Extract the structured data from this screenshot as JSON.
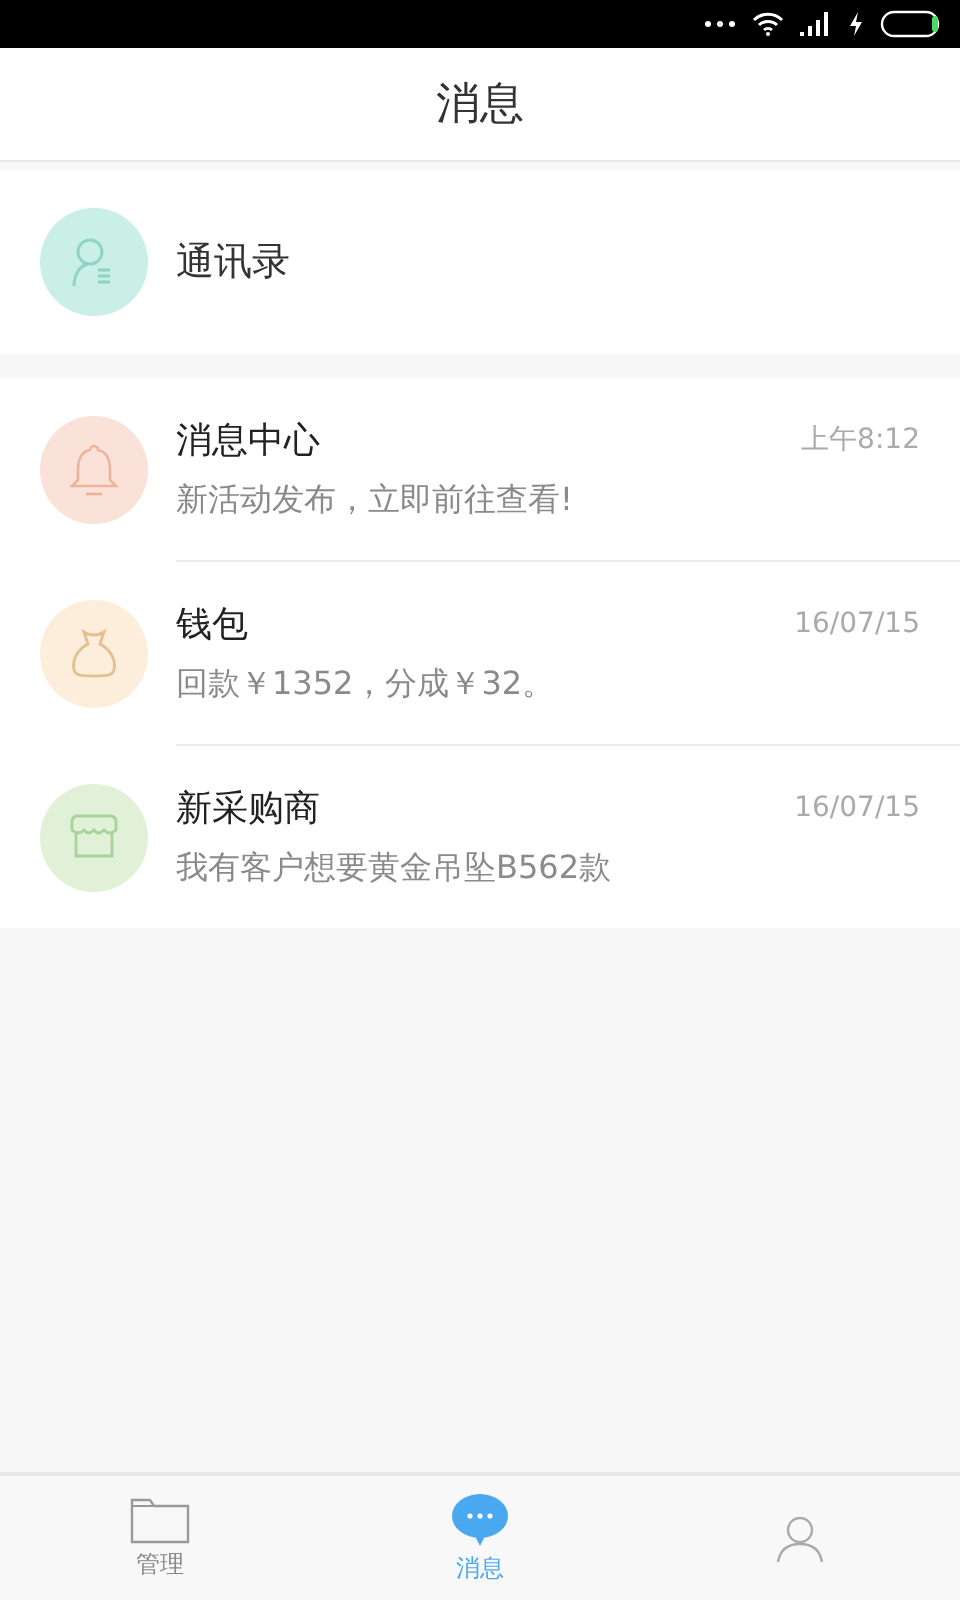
{
  "header": {
    "title": "消息"
  },
  "contacts": {
    "label": "通讯录",
    "color": "#c9efe6"
  },
  "messages": [
    {
      "title": "消息中心",
      "preview": "新活动发布，立即前往查看!",
      "time": "上午8:12",
      "color": "#fbe2d9"
    },
    {
      "title": "钱包",
      "preview": "回款￥1352，分成￥32。",
      "time": "16/07/15",
      "color": "#fdeedb"
    },
    {
      "title": "新采购商",
      "preview": "我有客户想要黄金吊坠B562款",
      "time": "16/07/15",
      "color": "#e0f1d8"
    }
  ],
  "tabs": [
    {
      "label": "管理",
      "selected": false
    },
    {
      "label": "消息",
      "selected": true
    },
    {
      "selected": false
    }
  ]
}
